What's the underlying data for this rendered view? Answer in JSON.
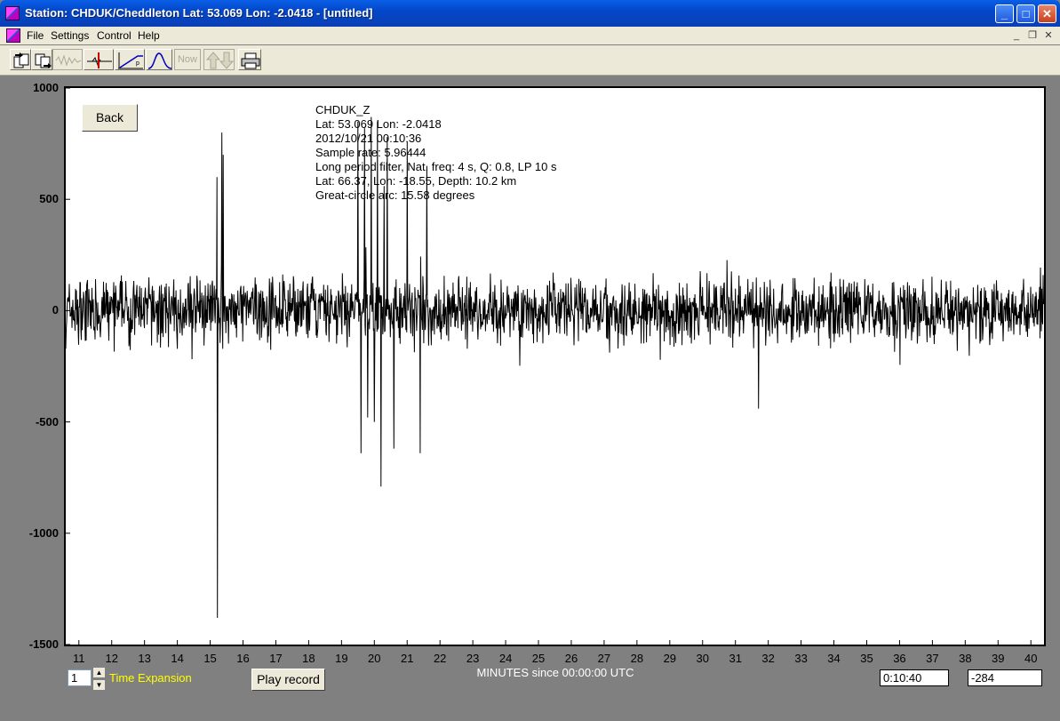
{
  "window": {
    "title": "Station: CHDUK/Cheddleton Lat: 53.069 Lon: -2.0418 - [untitled]",
    "controls": {
      "minimize": "_",
      "maximize": "□",
      "close": "✕"
    }
  },
  "menu": {
    "items": [
      "File",
      "Settings",
      "Control",
      "Help"
    ],
    "mdi": {
      "minimize": "_",
      "restore": "❐",
      "close": "✕"
    }
  },
  "toolbar": {
    "tools": [
      {
        "icon": "open-file-icon"
      },
      {
        "icon": "save-file-icon"
      },
      {
        "icon": "raw-trace-icon"
      },
      {
        "icon": "pick-marker-icon"
      },
      {
        "icon": "filter-response-icon"
      },
      {
        "icon": "spectrum-icon"
      },
      {
        "icon": "now-icon",
        "label": "Now"
      },
      {
        "icon": "up-down-arrows-icon"
      },
      {
        "icon": "print-icon"
      }
    ]
  },
  "plot": {
    "back_label": "Back",
    "info_lines": [
      "CHDUK_Z",
      "Lat: 53.069 Lon: -2.0418",
      "2012/10/21 00:10:36",
      "Sample rate: 5.96444",
      "Long period filter, Nat. freq: 4 s, Q: 0.8, LP 10 s",
      "Lat: 66.37, Lon: -18.55, Depth: 10.2 km",
      "Great-circle arc: 15.58 degrees"
    ],
    "colors": {
      "background": "#ffffff",
      "trace": "#000000",
      "frame": "#808080"
    }
  },
  "chart_data": {
    "type": "line",
    "xlabel": "MINUTES since 00:00:00 UTC",
    "ylabel": "",
    "xlim": [
      10.6,
      40.4
    ],
    "ylim": [
      -1500,
      1000
    ],
    "y_ticks": [
      "1000",
      "500",
      "0",
      "-500",
      "-1000",
      "-1500"
    ],
    "y_tick_values": [
      1000,
      500,
      0,
      -500,
      -1000,
      -1500
    ],
    "x_ticks": [
      "11",
      "12",
      "13",
      "14",
      "15",
      "16",
      "17",
      "18",
      "19",
      "20",
      "21",
      "22",
      "23",
      "24",
      "25",
      "26",
      "27",
      "28",
      "29",
      "30",
      "31",
      "32",
      "33",
      "34",
      "35",
      "36",
      "37",
      "38",
      "39",
      "40"
    ],
    "x_tick_values": [
      11,
      12,
      13,
      14,
      15,
      16,
      17,
      18,
      19,
      20,
      21,
      22,
      23,
      24,
      25,
      26,
      27,
      28,
      29,
      30,
      31,
      32,
      33,
      34,
      35,
      36,
      37,
      38,
      39,
      40
    ],
    "series": [
      {
        "values_note_x": [
          10.6,
          15.2,
          15.22,
          15.35,
          15.4,
          19.5,
          19.6,
          19.7,
          19.8,
          19.9,
          20.0,
          20.1,
          20.2,
          20.3,
          20.4,
          20.6,
          21.0,
          21.4,
          21.6,
          31.7,
          40.4
        ],
        "peaks": [
          150,
          600,
          -1380,
          800,
          700,
          850,
          -640,
          820,
          -480,
          870,
          -500,
          850,
          -790,
          560,
          780,
          -620,
          760,
          -640,
          650,
          -440,
          150
        ]
      }
    ],
    "grid": false
  },
  "footer": {
    "time_expansion_value": "1",
    "time_expansion_label": "Time Expansion",
    "play_label": "Play record",
    "time_readout": "0:10:40",
    "value_readout": "-284"
  }
}
